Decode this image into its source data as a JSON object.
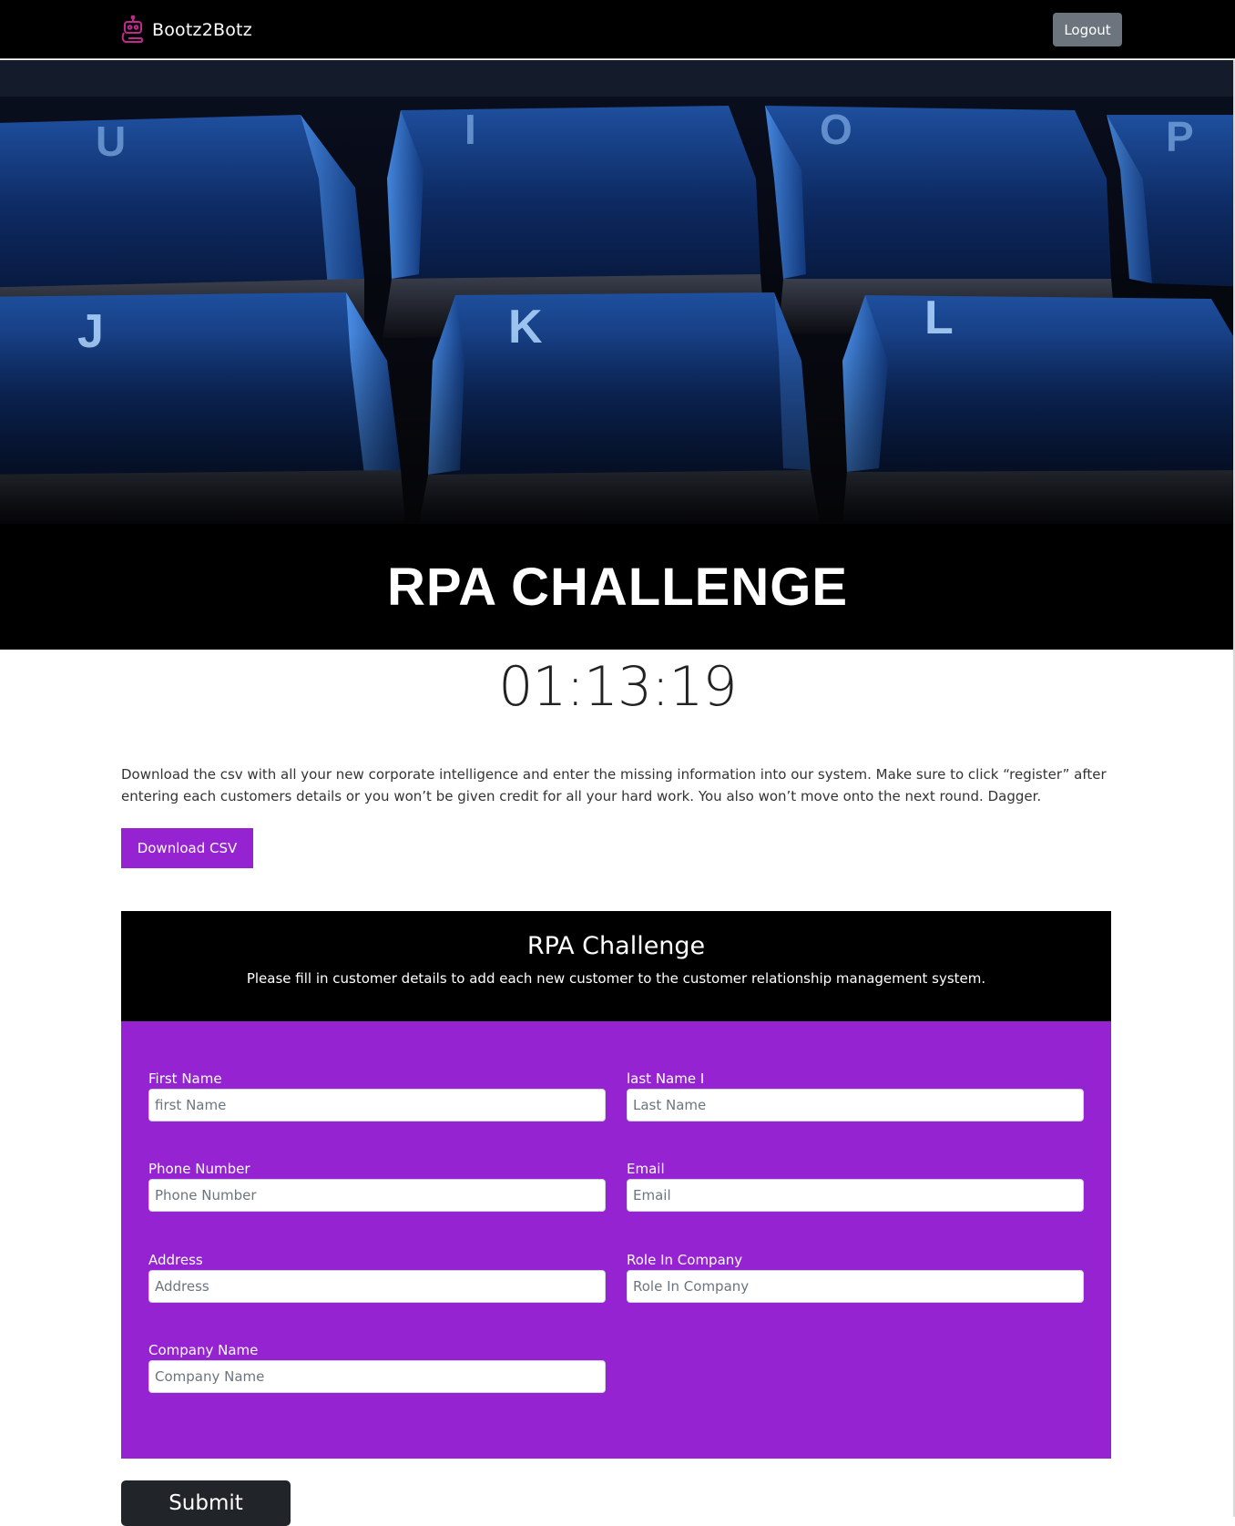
{
  "navbar": {
    "brand": "Bootz2Botz",
    "logout_label": "Logout"
  },
  "hero": {
    "title": "RPA CHALLENGE",
    "key_letters": [
      "U",
      "I",
      "O",
      "P",
      "J",
      "K",
      "L"
    ]
  },
  "timer": "01:13:19",
  "intro": {
    "text": "Download the csv with all your new corporate intelligence and enter the missing information into our system. Make sure to click “register” after entering each customers details or you won’t be given credit for all your hard work. You also won’t move onto the next round. Dagger.",
    "download_label": "Download CSV"
  },
  "form": {
    "title": "RPA Challenge",
    "subtitle": "Please fill in customer details to add each new customer to the customer relationship management system.",
    "fields": {
      "first_name": {
        "label": "First Name",
        "placeholder": "first Name"
      },
      "last_name": {
        "label": "last Name I",
        "placeholder": "Last Name"
      },
      "phone": {
        "label": "Phone Number",
        "placeholder": "Phone Number"
      },
      "email": {
        "label": "Email",
        "placeholder": "Email"
      },
      "address": {
        "label": "Address",
        "placeholder": "Address"
      },
      "role": {
        "label": "Role In Company",
        "placeholder": "Role In Company"
      },
      "company": {
        "label": "Company Name",
        "placeholder": "Company Name"
      }
    },
    "submit_label": "Submit"
  },
  "colors": {
    "accent": "#9523d2",
    "navbar": "#000000",
    "logout": "#6c757d",
    "submit": "#212529"
  }
}
